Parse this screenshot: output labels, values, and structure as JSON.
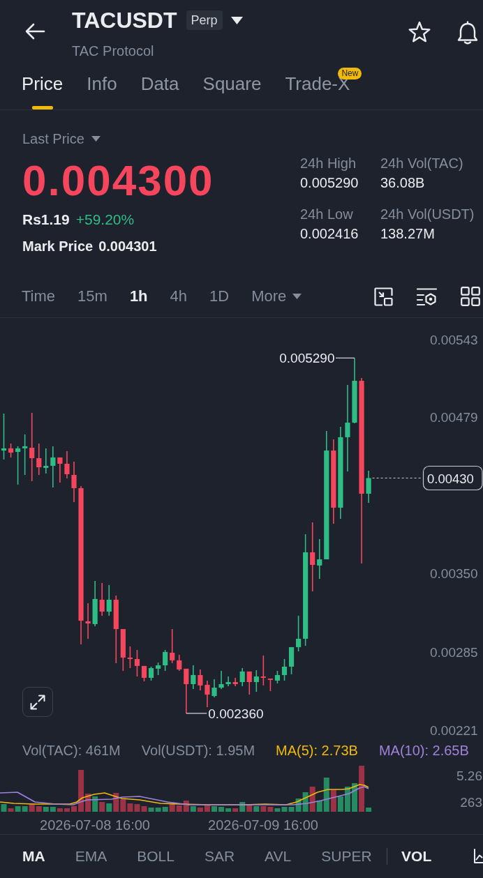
{
  "header": {
    "symbol": "TACUSDT",
    "contract_type": "Perp",
    "name": "TAC Protocol"
  },
  "tabs": [
    {
      "label": "Price",
      "selected": true
    },
    {
      "label": "Info",
      "selected": false
    },
    {
      "label": "Data",
      "selected": false
    },
    {
      "label": "Square",
      "selected": false
    },
    {
      "label": "Trade-X",
      "selected": false,
      "badge": "New"
    }
  ],
  "price": {
    "mode": "Last Price",
    "last_price": {
      "text": "0.004300",
      "rising": false
    },
    "fiat": "Rs1.19",
    "change": {
      "text": "+59.20%",
      "rising": true
    },
    "mark_label": "Mark Price",
    "mark_value": "0.004301"
  },
  "stats": [
    {
      "label": "24h High",
      "value": "0.005290"
    },
    {
      "label": "24h Vol(TAC)",
      "value": "36.08B"
    },
    {
      "label": "24h Low",
      "value": "0.002416"
    },
    {
      "label": "24h Vol(USDT)",
      "value": "138.27M"
    }
  ],
  "intervals": [
    {
      "label": "Time",
      "kind": "option",
      "selected": false
    },
    {
      "label": "15m",
      "kind": "option",
      "selected": false
    },
    {
      "label": "1h",
      "kind": "option",
      "selected": true
    },
    {
      "label": "4h",
      "kind": "option",
      "selected": false
    },
    {
      "label": "1D",
      "kind": "option",
      "selected": false
    },
    {
      "label": "More",
      "kind": "menu",
      "selected": false
    }
  ],
  "chart": {
    "chart_data": {
      "type": "candlestick",
      "categories": [
        null,
        null,
        null,
        null,
        null,
        null,
        null,
        null,
        null,
        null,
        null,
        null,
        null,
        null,
        null,
        null,
        null,
        null,
        null,
        null,
        null,
        null,
        null,
        null,
        null,
        null,
        null,
        null,
        null,
        null,
        null,
        null,
        null,
        null,
        null,
        null,
        null,
        null,
        null,
        null,
        null,
        null,
        null,
        null,
        null,
        null,
        null,
        null,
        null,
        null,
        null,
        null,
        null
      ],
      "ohlc": [
        [
          0.004527,
          0.004832,
          0.004453,
          0.004545
        ],
        [
          0.004545,
          0.004585,
          0.00447,
          0.00451
        ],
        [
          0.004516,
          0.004562,
          0.004246,
          0.004545
        ],
        [
          0.004545,
          0.00466,
          0.004326,
          0.004562
        ],
        [
          0.00455,
          0.004838,
          0.004274,
          0.004464
        ],
        [
          0.004464,
          0.004585,
          0.004326,
          0.004389
        ],
        [
          0.004384,
          0.004545,
          0.004338,
          0.004401
        ],
        [
          0.004401,
          0.004562,
          0.004223,
          0.00447
        ],
        [
          0.00447,
          0.00447,
          0.004263,
          0.004418
        ],
        [
          0.004418,
          0.004522,
          0.004297,
          0.004332
        ],
        [
          0.004326,
          0.004435,
          0.004102,
          0.004217
        ],
        [
          0.004217,
          0.004234,
          0.002929,
          0.003124
        ],
        [
          0.003119,
          0.003268,
          0.002975,
          0.003101
        ],
        [
          0.003096,
          0.003452,
          0.003078,
          0.003303
        ],
        [
          0.003297,
          0.003435,
          0.003165,
          0.003199
        ],
        [
          0.003199,
          0.003418,
          0.003165,
          0.003297
        ],
        [
          0.003297,
          0.003331,
          0.002774,
          0.003055
        ],
        [
          0.003055,
          0.003055,
          0.00271,
          0.00282
        ],
        [
          0.00282,
          0.002912,
          0.002733,
          0.002808
        ],
        [
          0.002808,
          0.002883,
          0.002664,
          0.002751
        ],
        [
          0.002751,
          0.002751,
          0.002624,
          0.002653
        ],
        [
          0.002653,
          0.002745,
          0.00263,
          0.002733
        ],
        [
          0.002728,
          0.002779,
          0.002676,
          0.002756
        ],
        [
          0.002756,
          0.002883,
          0.00271,
          0.002866
        ],
        [
          0.00286,
          0.003055,
          0.002774,
          0.002797
        ],
        [
          0.002797,
          0.002843,
          0.00271,
          0.002722
        ],
        [
          0.002728,
          0.002728,
          0.00236,
          0.002601
        ],
        [
          0.002601,
          0.002756,
          0.002561,
          0.002676
        ],
        [
          0.002676,
          0.002722,
          0.002549,
          0.00259
        ],
        [
          0.002595,
          0.00263,
          0.002411,
          0.002515
        ],
        [
          0.002503,
          0.002641,
          0.002492,
          0.002572
        ],
        [
          0.002572,
          0.00271,
          0.002561,
          0.002601
        ],
        [
          0.002601,
          0.002664,
          0.002584,
          0.002618
        ],
        [
          0.002618,
          0.002653,
          0.002584,
          0.002601
        ],
        [
          0.002618,
          0.002733,
          0.002584,
          0.002705
        ],
        [
          0.002705,
          0.002705,
          0.002515,
          0.002618
        ],
        [
          0.002618,
          0.002716,
          0.002538,
          0.002664
        ],
        [
          0.002664,
          0.002837,
          0.00259,
          0.002653
        ],
        [
          0.002647,
          0.002647,
          0.002544,
          0.002636
        ],
        [
          0.00263,
          0.00271,
          0.002607,
          0.002676
        ],
        [
          0.002676,
          0.002808,
          0.00263,
          0.002745
        ],
        [
          0.002745,
          0.002906,
          0.002682,
          0.002906
        ],
        [
          0.002906,
          0.003165,
          0.002871,
          0.002975
        ],
        [
          0.002975,
          0.003837,
          0.002917,
          0.003688
        ],
        [
          0.003688,
          0.003935,
          0.003366,
          0.003584
        ],
        [
          0.003579,
          0.003797,
          0.003469,
          0.00363
        ],
        [
          0.00363,
          0.004688,
          0.00363,
          0.004527
        ],
        [
          0.004527,
          0.004619,
          0.003924,
          0.004056
        ],
        [
          0.004056,
          0.004723,
          0.003964,
          0.004637
        ],
        [
          0.004637,
          0.005068,
          0.004355,
          0.004757
        ],
        [
          0.004757,
          0.00529,
          0.004752,
          0.005102
        ],
        [
          0.005102,
          0.005125,
          0.003596,
          0.004171
        ],
        [
          0.004171,
          0.004361,
          0.004096,
          0.0043
        ]
      ],
      "ylim": [
        0.00221,
        0.00543
      ],
      "yticks": [
        {
          "value": 0.00543,
          "label": "0.00543"
        },
        {
          "value": 0.00479,
          "label": "0.00479"
        },
        {
          "value": 0.0035,
          "label": "0.00350"
        },
        {
          "value": 0.00285,
          "label": "0.00285"
        },
        {
          "value": 0.00221,
          "label": "0.00221"
        }
      ]
    },
    "high_label": "0.005290",
    "low_label": "0.002360",
    "current_price": "0.00430"
  },
  "volume": {
    "legend": [
      {
        "text": "Vol(TAC): 461M"
      },
      {
        "text": "Vol(USDT): 1.95M"
      },
      {
        "text": "MA(5): 2.73B",
        "color": "#f0b90b"
      },
      {
        "text": "MA(10): 2.65B",
        "color": "#9e83db"
      }
    ],
    "axis_labels": [
      "5.26",
      "263"
    ],
    "dates": [
      "2026-07-08 16:00",
      "2026-07-09 16:00"
    ]
  },
  "indicators": {
    "main": [
      {
        "label": "MA",
        "selected": true
      },
      {
        "label": "EMA",
        "selected": false
      },
      {
        "label": "BOLL",
        "selected": false
      },
      {
        "label": "SAR",
        "selected": false
      },
      {
        "label": "AVL",
        "selected": false
      },
      {
        "label": "SUPER",
        "selected": false
      }
    ],
    "sub": [
      {
        "label": "VOL",
        "selected": true
      }
    ]
  }
}
